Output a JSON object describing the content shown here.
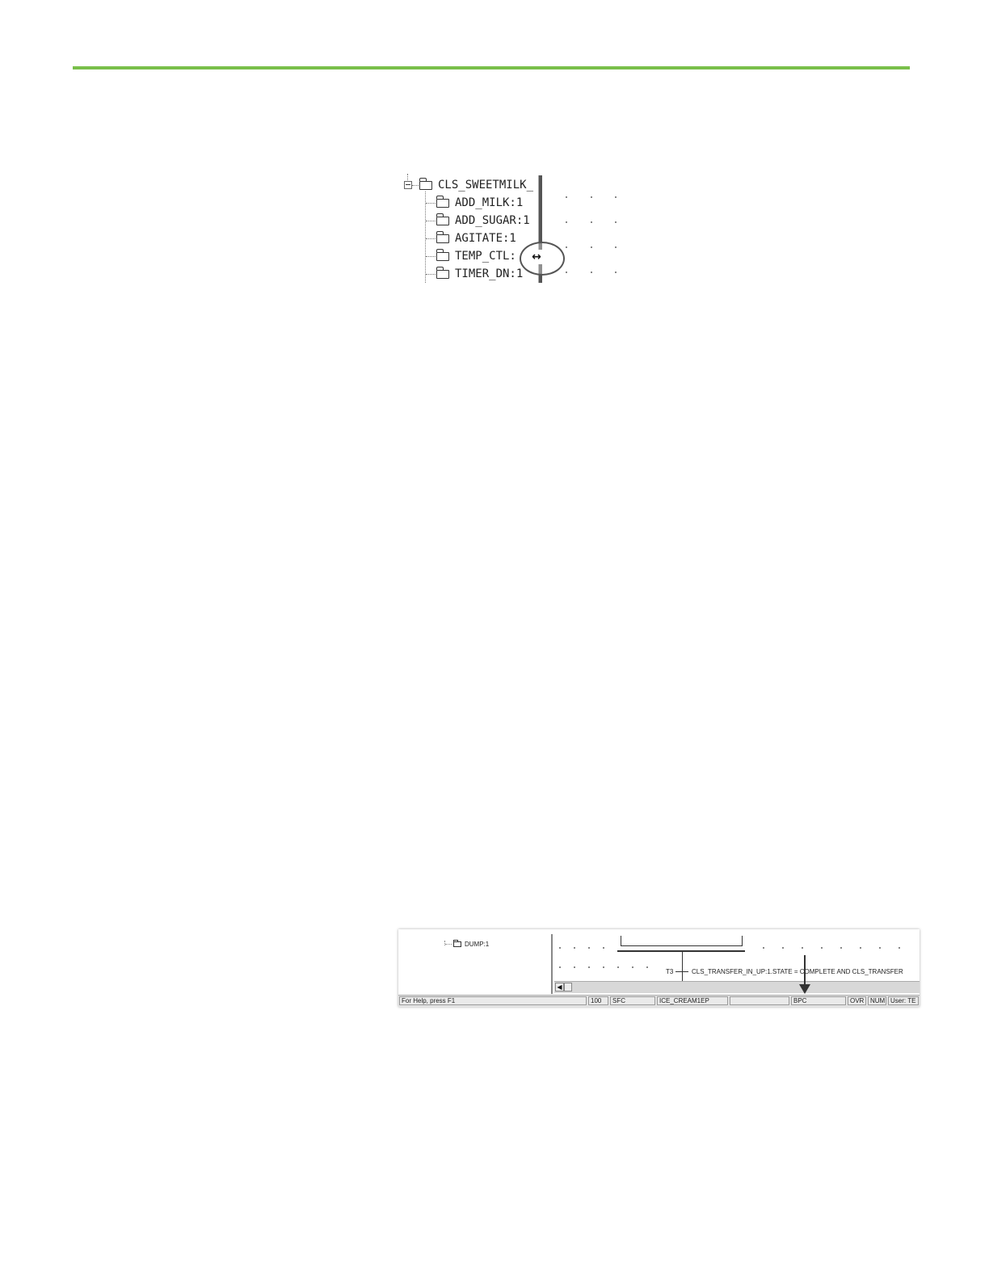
{
  "colors": {
    "rule": "#79bf4a"
  },
  "tree": {
    "root_label": "CLS_SWEETMILK_",
    "items": [
      {
        "label": "ADD_MILK:1"
      },
      {
        "label": "ADD_SUGAR:1"
      },
      {
        "label": "AGITATE:1"
      },
      {
        "label": "TEMP_CTL:"
      },
      {
        "label": "TIMER_DN:1"
      }
    ],
    "cursor_glyph": "↔"
  },
  "editor": {
    "tree_item": "DUMP:1",
    "transition_id": "T3",
    "transition_expr": "CLS_TRANSFER_IN_UP:1.STATE = COMPLETE AND CLS_TRANSFER",
    "scroll_left_glyph": "◀"
  },
  "status_bar": {
    "help": "For Help, press F1",
    "zoom": "100",
    "mode": "SFC",
    "routine": "ICE_CREAM1EP",
    "blank": "",
    "sfc_type": "BPC",
    "ovr": "OVR",
    "num": "NUM",
    "user": "User: TE"
  }
}
